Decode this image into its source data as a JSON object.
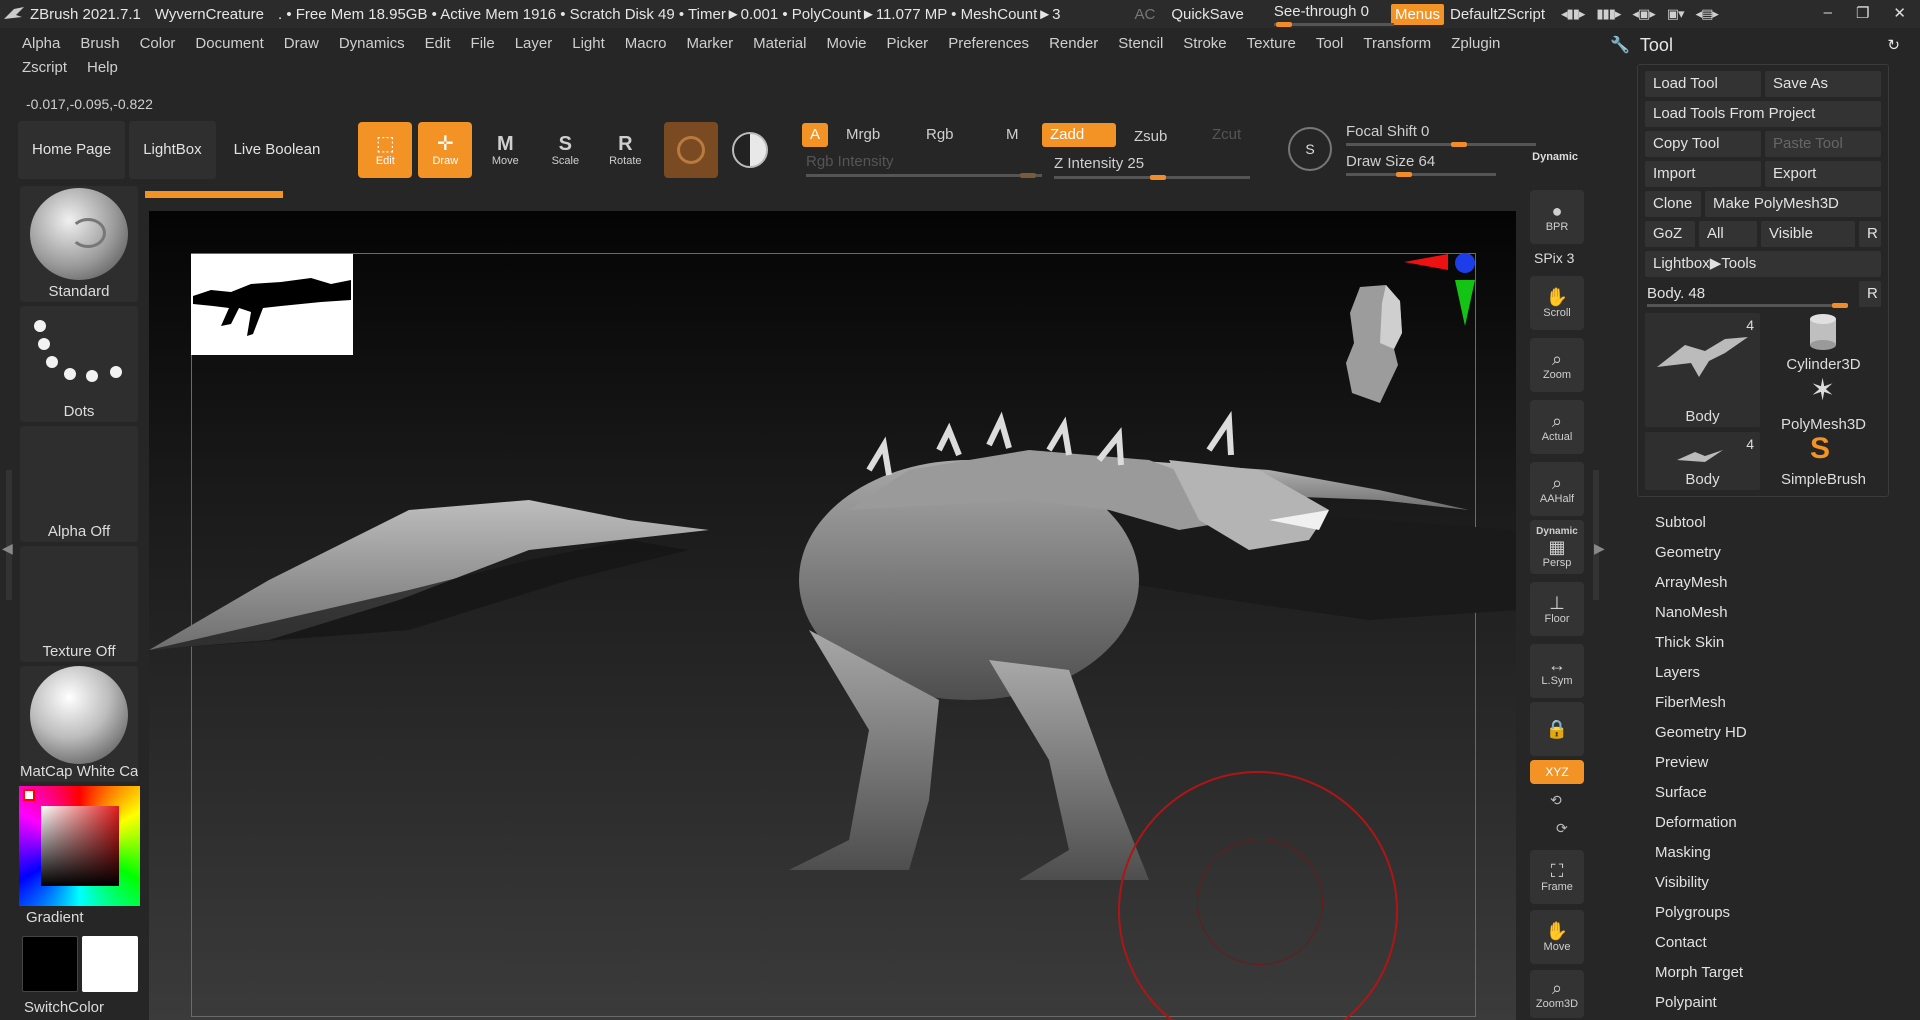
{
  "titlebar": {
    "app": "ZBrush 2021.7.1",
    "project": "WyvernCreature",
    "stats": ". • Free Mem 18.95GB • Active Mem 1916 • Scratch Disk 49 • Timer►0.001 • PolyCount►11.077 MP • MeshCount►3",
    "ac": "AC",
    "quicksave": "QuickSave",
    "see_through": "See-through 0",
    "menus": "Menus",
    "script": "DefaultZScript"
  },
  "menubar": {
    "items": [
      "Alpha",
      "Brush",
      "Color",
      "Document",
      "Draw",
      "Dynamics",
      "Edit",
      "File",
      "Layer",
      "Light",
      "Macro",
      "Marker",
      "Material",
      "Movie",
      "Picker",
      "Preferences",
      "Render",
      "Stencil",
      "Stroke",
      "Texture",
      "Tool",
      "Transform",
      "Zplugin",
      "Zscript",
      "Help"
    ]
  },
  "coords": "-0.017,-0.095,-0.822",
  "shelf": {
    "home": "Home Page",
    "lightbox": "LightBox",
    "live_boolean": "Live Boolean",
    "edit": "Edit",
    "draw": "Draw",
    "move": "Move",
    "scale": "Scale",
    "rotate": "Rotate"
  },
  "mrgb": {
    "a": "A",
    "mrgb": "Mrgb",
    "rgb": "Rgb",
    "m": "M",
    "zadd": "Zadd",
    "zsub": "Zsub",
    "zcut": "Zcut",
    "rgb_intensity": "Rgb Intensity",
    "z_intensity": "Z Intensity 25"
  },
  "focal": {
    "focal_shift": "Focal Shift 0",
    "draw_size": "Draw Size 64",
    "dynamic": "Dynamic",
    "icon_letter": "S"
  },
  "left_panel": {
    "brush": "Standard",
    "stroke": "Dots",
    "alpha": "Alpha Off",
    "texture": "Texture Off",
    "material": "MatCap White Cav",
    "gradient": "Gradient",
    "switch": "SwitchColor"
  },
  "right_bar": {
    "bpr": "BPR",
    "spix": "SPix 3",
    "scroll": "Scroll",
    "zoom": "Zoom",
    "actual": "Actual",
    "aahalf": "AAHalf",
    "dynamic": "Dynamic",
    "persp": "Persp",
    "floor": "Floor",
    "lsym": "L.Sym",
    "xyz": "XYZ",
    "frame": "Frame",
    "move": "Move",
    "zoom3d": "Zoom3D"
  },
  "tool_panel": {
    "title": "Tool",
    "load_tool": "Load Tool",
    "save_as": "Save As",
    "load_from_project": "Load Tools From Project",
    "copy_tool": "Copy Tool",
    "paste_tool": "Paste Tool",
    "import": "Import",
    "export": "Export",
    "clone": "Clone",
    "make_polymesh": "Make PolyMesh3D",
    "goz": "GoZ",
    "all": "All",
    "visible": "Visible",
    "r": "R",
    "lightbox_tools": "Lightbox▶Tools",
    "body_slider": "Body. 48",
    "thumbs": [
      {
        "label": "Body",
        "count": "4"
      },
      {
        "label": "Cylinder3D"
      },
      {
        "label": "PolyMesh3D"
      },
      {
        "label": "Body",
        "count": "4"
      },
      {
        "label": "SimpleBrush"
      }
    ],
    "subpalettes": [
      "Subtool",
      "Geometry",
      "ArrayMesh",
      "NanoMesh",
      "Thick Skin",
      "Layers",
      "FiberMesh",
      "Geometry HD",
      "Preview",
      "Surface",
      "Deformation",
      "Masking",
      "Visibility",
      "Polygroups",
      "Contact",
      "Morph Target",
      "Polypaint"
    ]
  },
  "colors": {
    "accent": "#f39225",
    "primary": "#000000",
    "secondary": "#ffffff"
  }
}
